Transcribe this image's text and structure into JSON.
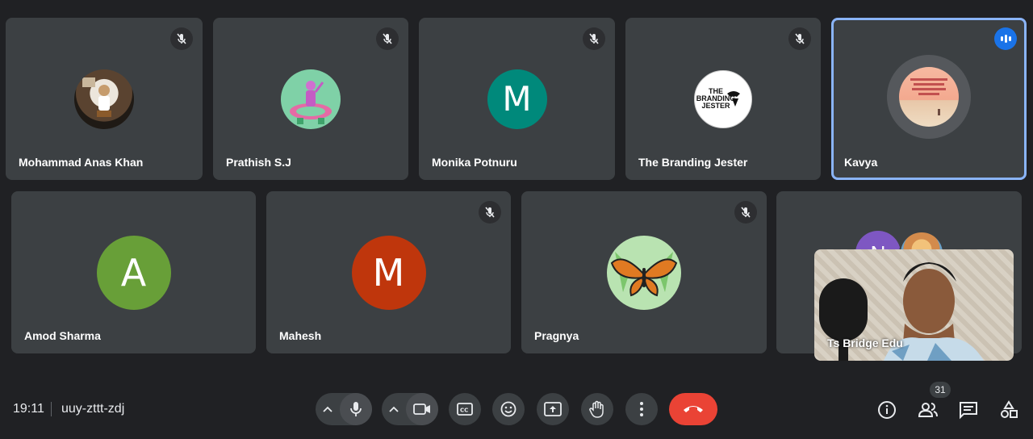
{
  "participants": [
    {
      "name": "Mohammad Anas Khan",
      "muted": true,
      "avatar_type": "photo"
    },
    {
      "name": "Prathish S.J",
      "muted": true,
      "avatar_type": "photo"
    },
    {
      "name": "Monika Potnuru",
      "muted": true,
      "avatar_type": "letter",
      "letter": "M",
      "color": "#00897b"
    },
    {
      "name": "The Branding Jester",
      "muted": true,
      "avatar_type": "logo",
      "logo_text": [
        "THE",
        "BRANDING",
        "JESTER"
      ]
    },
    {
      "name": "Kavya",
      "muted": false,
      "speaking": true,
      "avatar_type": "photo"
    },
    {
      "name": "Amod Sharma",
      "muted": false,
      "avatar_type": "letter",
      "letter": "A",
      "color": "#689f38"
    },
    {
      "name": "Mahesh",
      "muted": true,
      "avatar_type": "letter",
      "letter": "M",
      "color": "#bf360c"
    },
    {
      "name": "Pragnya",
      "muted": true,
      "avatar_type": "photo"
    }
  ],
  "overflow_tile": {
    "letter": "N",
    "color": "#7e57c2"
  },
  "self_view": {
    "name": "Ts Bridge Edu"
  },
  "meeting": {
    "time": "19:11",
    "code": "uuy-zttt-zdj"
  },
  "people_count": "31",
  "colors": {
    "background": "#202124",
    "tile": "#3c4043",
    "active_border": "#8ab4f8",
    "hangup": "#ea4335",
    "speaking": "#1a73e8"
  },
  "controls": [
    "mic-options-chevron",
    "mic-icon",
    "camera-options-chevron",
    "camera-icon",
    "captions-icon",
    "emoji-icon",
    "present-icon",
    "raise-hand-icon",
    "more-options-icon",
    "hangup-icon"
  ],
  "side_controls": [
    "info-icon",
    "people-icon",
    "chat-icon",
    "activities-icon"
  ]
}
